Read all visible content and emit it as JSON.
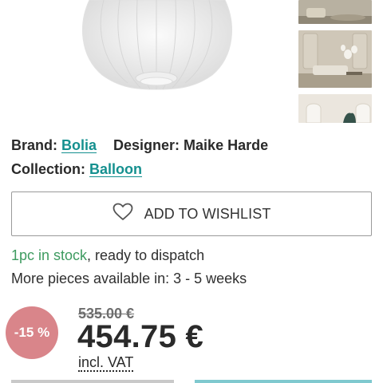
{
  "product": {
    "brand_label": "Brand:",
    "brand_value": "Bolia",
    "designer_label": "Designer:",
    "designer_value": "Maike Harde",
    "collection_label": "Collection:",
    "collection_value": "Balloon"
  },
  "wishlist": {
    "label": "ADD TO WISHLIST",
    "icon": "heart-outline-icon"
  },
  "stock": {
    "highlight": "1pc in stock",
    "rest": ", ready to dispatch",
    "more": "More pieces available in: 3 - 5 weeks"
  },
  "pricing": {
    "discount": "-15 %",
    "old_price": "535.00 €",
    "price": "454.75 €",
    "vat": "incl. VAT"
  },
  "colors": {
    "accent": "#15908f",
    "stock_green": "#3e9b60",
    "discount_badge": "#d9858a"
  }
}
